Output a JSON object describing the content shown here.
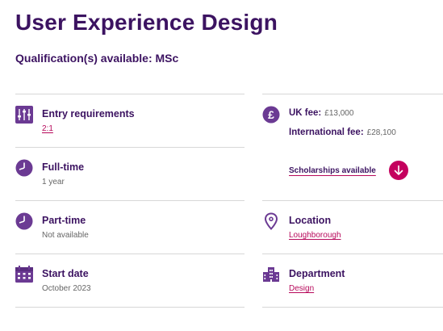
{
  "title": "User Experience Design",
  "subtitle": "Qualification(s) available: MSc",
  "colors": {
    "brand_purple": "#3c1361",
    "icon_purple": "#6b3a93",
    "link_pink": "#b7095b",
    "button_pink": "#c4005e",
    "muted_text": "#666666",
    "divider": "#d7d7d7"
  },
  "left": {
    "entry": {
      "label": "Entry requirements",
      "value": "2:1",
      "icon": "sliders-icon"
    },
    "fulltime": {
      "label": "Full-time",
      "value": "1 year",
      "icon": "clock-icon"
    },
    "parttime": {
      "label": "Part-time",
      "value": "Not available",
      "icon": "clock-icon"
    },
    "start": {
      "label": "Start date",
      "value": "October 2023",
      "icon": "calendar-icon"
    }
  },
  "right": {
    "fees": {
      "icon": "pound-icon",
      "uk_label": "UK fee:",
      "uk_value": "£13,000",
      "intl_label": "International fee:",
      "intl_value": "£28,100"
    },
    "scholarships": {
      "label": "Scholarships available",
      "icon": "arrow-down-icon"
    },
    "location": {
      "label": "Location",
      "value": "Loughborough",
      "icon": "location-pin-icon"
    },
    "department": {
      "label": "Department",
      "value": "Design",
      "icon": "building-icon"
    }
  }
}
